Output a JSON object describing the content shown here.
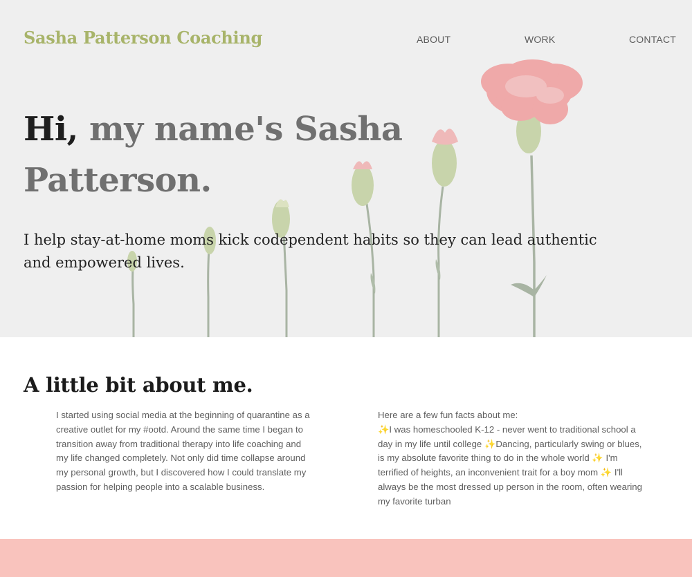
{
  "header": {
    "brand": "Sasha Patterson Coaching",
    "nav": [
      {
        "label": "ABOUT"
      },
      {
        "label": "WORK"
      },
      {
        "label": "CONTACT"
      }
    ]
  },
  "hero": {
    "headline_hi": "Hi,",
    "headline_rest": " my name's Sasha Patterson.",
    "tagline": "I help stay-at-home moms kick codependent habits so they can lead authentic and empowered lives."
  },
  "about": {
    "title": "A little bit about me.",
    "left_text": "I started using social media at the beginning of quarantine as a creative outlet for my #ootd. Around the same time I began to transition away from traditional therapy into life coaching and my life changed completely. Not only did time collapse around my personal growth, but I discovered how I could translate my passion for helping people into a scalable business.",
    "right_intro": "Here are a few fun facts about me:",
    "facts": [
      "I was homeschooled K-12 - never went to traditional school a day in my life until college",
      "Dancing, particularly swing or blues, is my absolute favorite thing to do in the whole world",
      "I'm terrified of heights, an inconvenient trait for a boy mom",
      "I'll always be the most dressed up person in the room, often wearing my favorite turban"
    ],
    "sparkle_glyph": "✨"
  },
  "colors": {
    "brand": "#a8b46a",
    "hero_bg": "#efefef",
    "band": "#f9c3bd",
    "flower": "#f08e8e",
    "stem": "#6f8466"
  }
}
